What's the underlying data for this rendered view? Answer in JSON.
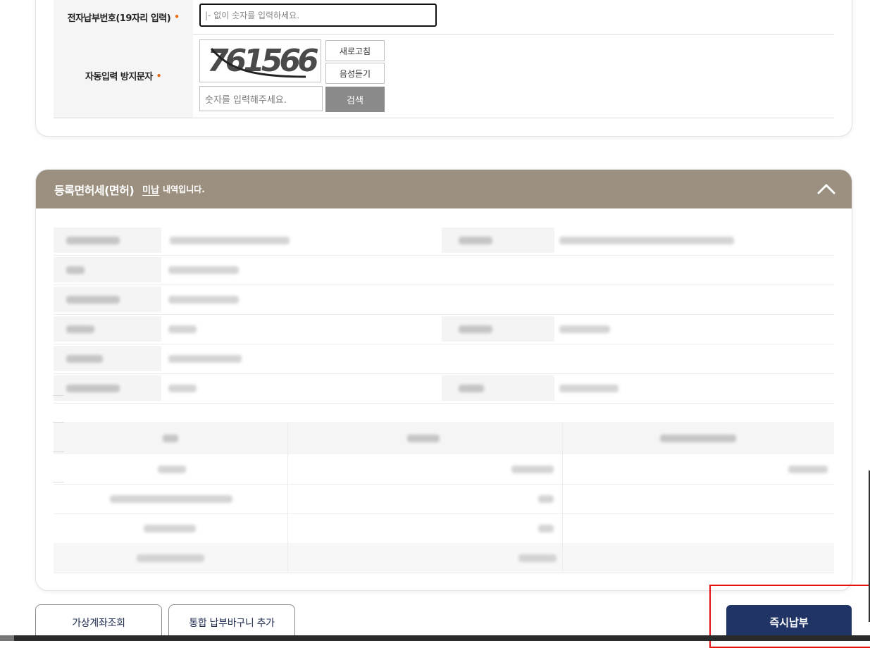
{
  "search_form": {
    "electronic_payment_label": "전자납부번호(19자리 입력)",
    "required_mark": "•",
    "electronic_payment_placeholder": "|- 없이 숫자를 입력하세요.",
    "captcha_label": "자동입력 방지문자",
    "captcha_value": "761566",
    "refresh_label": "새로고침",
    "audio_label": "음성듣기",
    "captcha_input_placeholder": "숫자를 입력해주세요.",
    "search_button": "검색"
  },
  "detail": {
    "title": "등록면허세(면허)",
    "status": "미납",
    "status_suffix": "내역입니다."
  },
  "actions": {
    "virtual_account": "가상계좌조회",
    "add_to_cart": "통합 납부바구니 추가",
    "pay_now": "즉시납부"
  },
  "colors": {
    "header_bg": "#9b9080",
    "pay_button": "#213466",
    "required": "#e8670e",
    "highlight": "#e61010"
  }
}
